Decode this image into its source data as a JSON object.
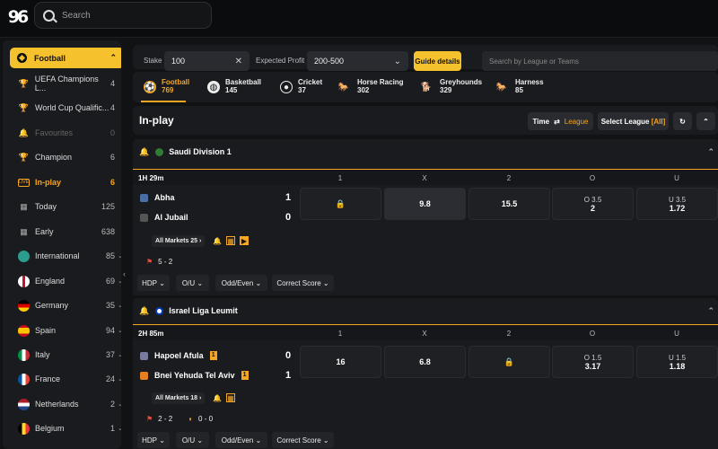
{
  "search": {
    "placeholder": "Search"
  },
  "logo": {
    "text": "96"
  },
  "sidebar": {
    "header": "Football",
    "items": [
      {
        "label": "UEFA Champions L...",
        "count": "4",
        "icon": "trophy-icon"
      },
      {
        "label": "World Cup Qualific...",
        "count": "4",
        "icon": "trophy-icon"
      },
      {
        "label": "Favourites",
        "count": "0",
        "icon": "bell-icon"
      },
      {
        "label": "Champion",
        "count": "6",
        "icon": "trophy-icon"
      },
      {
        "label": "In-play",
        "count": "6",
        "icon": "live-icon"
      },
      {
        "label": "Today",
        "count": "125",
        "icon": "calendar-icon"
      },
      {
        "label": "Early",
        "count": "638",
        "icon": "calendar-icon"
      },
      {
        "label": "International",
        "count": "85",
        "icon": "globe-icon"
      },
      {
        "label": "England",
        "count": "69",
        "icon": "england-flag"
      },
      {
        "label": "Germany",
        "count": "35",
        "icon": "germany-flag"
      },
      {
        "label": "Spain",
        "count": "94",
        "icon": "spain-flag"
      },
      {
        "label": "Italy",
        "count": "37",
        "icon": "italy-flag"
      },
      {
        "label": "France",
        "count": "24",
        "icon": "france-flag"
      },
      {
        "label": "Netherlands",
        "count": "2",
        "icon": "netherlands-flag"
      },
      {
        "label": "Belgium",
        "count": "1",
        "icon": "belgium-flag"
      }
    ]
  },
  "betbar": {
    "stake_label": "Stake",
    "stake_value": "100",
    "profit_label": "Expected Profit",
    "profit_value": "200-500",
    "guide": "Guide details",
    "league_search": "Search by League or Teams"
  },
  "sports": [
    {
      "name": "Football",
      "count": "769"
    },
    {
      "name": "Basketball",
      "count": "145"
    },
    {
      "name": "Cricket",
      "count": "37"
    },
    {
      "name": "Horse Racing",
      "count": "302"
    },
    {
      "name": "Greyhounds",
      "count": "329"
    },
    {
      "name": "Harness",
      "count": "85"
    }
  ],
  "inplay": {
    "title": "In-play",
    "time": "Time",
    "league": "League",
    "select_league": "Select League",
    "all": "[All]"
  },
  "columns": {
    "c1": "1",
    "cx": "X",
    "c2": "2",
    "co": "O",
    "cu": "U"
  },
  "filters": {
    "hdp": "HDP",
    "ou": "O/U",
    "oddeven": "Odd/Even",
    "correct": "Correct Score"
  },
  "leagues": [
    {
      "name": "Saudi Division 1",
      "time": "1H 29m",
      "home": "Abha",
      "away": "Al Jubail",
      "home_score": "1",
      "away_score": "0",
      "markets": "All Markets 25",
      "stats": "5 - 2",
      "stats2": "",
      "odds": {
        "one": "",
        "x": "9.8",
        "two": "15.5",
        "o_line": "O 3.5",
        "o_val": "2",
        "u_line": "U 3.5",
        "u_val": "1.72"
      }
    },
    {
      "name": "Israel Liga Leumit",
      "time": "2H 85m",
      "home": "Hapoel Afula",
      "away": "Bnei Yehuda Tel Aviv",
      "home_score": "0",
      "away_score": "1",
      "markets": "All Markets 18",
      "stats": "2 - 2",
      "stats2": "0 - 0",
      "odds": {
        "one": "16",
        "x": "6.8",
        "two": "",
        "o_line": "O 1.5",
        "o_val": "3.17",
        "u_line": "U 1.5",
        "u_val": "1.18"
      }
    }
  ],
  "colors": {
    "accent": "#f5c12d",
    "live": "#f5a623",
    "bg": "#111214",
    "panel": "#1a1b1e"
  }
}
